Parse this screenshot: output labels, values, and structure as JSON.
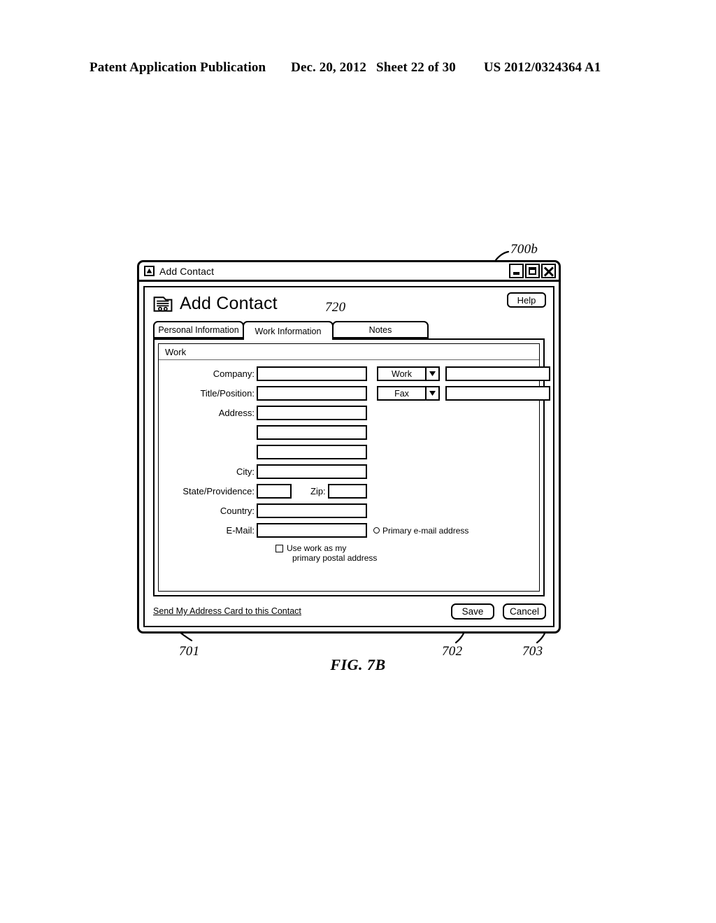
{
  "patent_header": {
    "publication": "Patent Application Publication",
    "date": "Dec. 20, 2012",
    "sheet": "Sheet 22 of 30",
    "number": "US 2012/0324364 A1"
  },
  "figure": {
    "label": "FIG. 7B",
    "callouts": {
      "window": "700b",
      "active_tab": "720",
      "send_card_link": "701",
      "save_button": "702",
      "cancel_button": "703"
    }
  },
  "window": {
    "title": "Add Contact",
    "title_icon": "triangle-app-icon",
    "controls": {
      "minimize": "minimize-icon",
      "maximize": "maximize-icon",
      "close": "close-icon"
    }
  },
  "dialog": {
    "heading": "Add Contact",
    "heading_icon": "contact-card-icon",
    "help_label": "Help",
    "tabs": [
      {
        "label": "Personal Information",
        "active": false
      },
      {
        "label": "Work Information",
        "active": true
      },
      {
        "label": "Notes",
        "active": false
      }
    ],
    "group": {
      "title": "Work",
      "fields": [
        {
          "label": "Company:",
          "value": "",
          "placeholder": ""
        },
        {
          "label": "Title/Position:",
          "value": "",
          "placeholder": ""
        },
        {
          "label": "Address:",
          "value": "",
          "placeholder": ""
        },
        {
          "label": "",
          "value": "",
          "placeholder": ""
        },
        {
          "label": "",
          "value": "",
          "placeholder": ""
        },
        {
          "label": "City:",
          "value": "",
          "placeholder": ""
        },
        {
          "label": "State/Providence:",
          "value": "",
          "placeholder": ""
        },
        {
          "label": "Zip:",
          "value": "",
          "placeholder": ""
        },
        {
          "label": "Country:",
          "value": "",
          "placeholder": ""
        },
        {
          "label": "E-Mail:",
          "value": "",
          "placeholder": ""
        }
      ],
      "phone_rows": [
        {
          "type": "Work",
          "value": "",
          "placeholder": ""
        },
        {
          "type": "Fax",
          "value": "",
          "placeholder": ""
        }
      ],
      "phone_type_options": [
        "Work",
        "Fax"
      ],
      "primary_email_label": "Primary e-mail address",
      "primary_email_checked": false,
      "use_work_checkbox": {
        "line1": "Use work as my",
        "line2": "primary postal address",
        "checked": false
      }
    },
    "footer": {
      "send_card_link": "Send My Address Card to this Contact",
      "save_label": "Save",
      "cancel_label": "Cancel"
    }
  },
  "colors": {
    "ink": "#000000",
    "paper": "#ffffff",
    "group_rule": "#666666"
  }
}
